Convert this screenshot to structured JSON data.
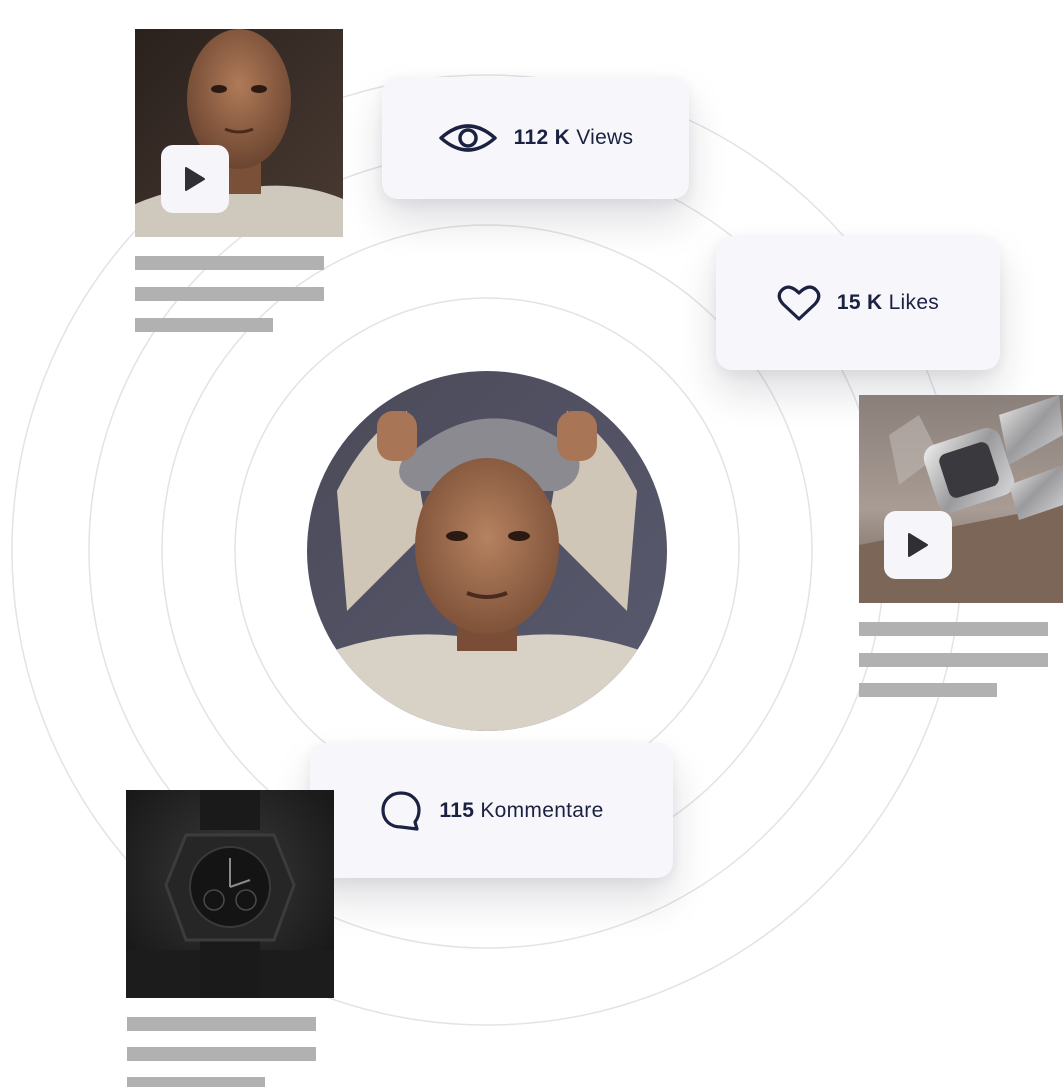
{
  "stats": {
    "views": {
      "value": "112 K",
      "label": "Views",
      "icon": "eye-icon"
    },
    "likes": {
      "value": "15 K",
      "label": "Likes",
      "icon": "heart-icon"
    },
    "comments": {
      "value": "115",
      "label": "Kommentare",
      "icon": "comment-bubble-icon"
    }
  },
  "posts": [
    {
      "type": "video",
      "subject": "portrait",
      "progress_lines": 3
    },
    {
      "type": "video",
      "subject": "watch",
      "progress_lines": 3
    },
    {
      "type": "image",
      "subject": "watch",
      "progress_lines": 3
    }
  ],
  "colors": {
    "card_bg": "#f7f7fb",
    "text": "#1b2140",
    "placeholder_bar": "#b1b1b1",
    "ring": "#e2e2e6"
  }
}
